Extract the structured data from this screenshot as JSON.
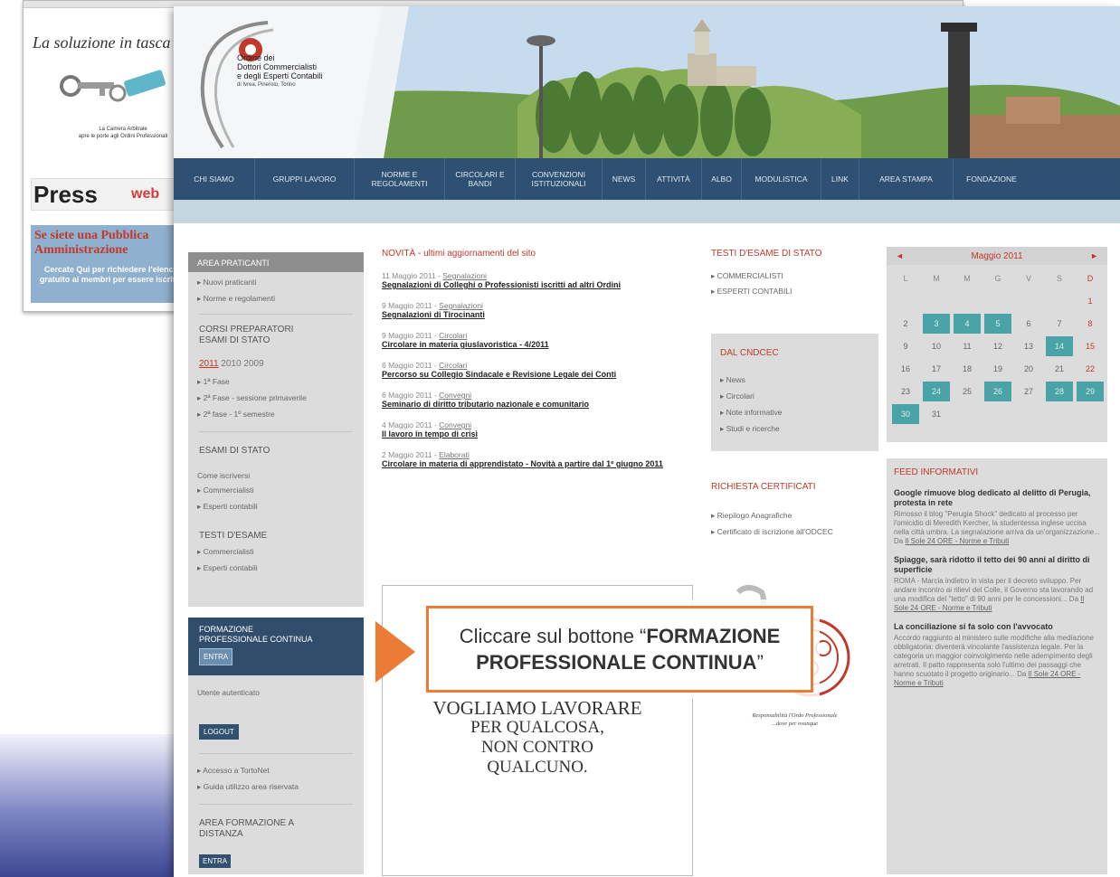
{
  "background_window": {
    "tagline": "La soluzione in tasca",
    "keys_caption_1": "La Camera Arbitrale",
    "keys_caption_2": "apre le porte agli Ordini Professionali",
    "press_label": "Press",
    "press_suffix": "web",
    "ad_title": "Se siete una Pubblica Amministrazione",
    "ad_body": "Cercate Qui per richiedere l'elenco gratuito ai membri per essere iscritti!"
  },
  "header": {
    "org_line1": "Ordine dei",
    "org_line2": "Dottori Commercialisti",
    "org_line3": "e degli Esperti Contabili",
    "org_line4": "di Ivrea, Pinerolo, Torino"
  },
  "nav": {
    "items": [
      "CHI SIAMO",
      "GRUPPI LAVORO",
      "NORME E REGOLAMENTI",
      "CIRCOLARI E BANDI",
      "CONVENZIONI ISTITUZIONALI",
      "NEWS",
      "ATTIVITÀ",
      "ALBO",
      "MODULISTICA",
      "LINK",
      "AREA STAMPA",
      "FONDAZIONE"
    ]
  },
  "left": {
    "area_praticanti": "AREA PRATICANTI",
    "praticanti_items": [
      "Nuovi praticanti",
      "Norme e regolamenti"
    ],
    "corsi_head_1": "CORSI PREPARATORI",
    "corsi_head_2": "ESAMI DI STATO",
    "year_selected": "2011",
    "year_2": "2010",
    "year_3": "2009",
    "fasi": [
      "1ª Fase",
      "2ª Fase - sessione primaverile",
      "2ª fase - 1º semestre"
    ],
    "esami_head": "ESAMI DI STATO",
    "esami_sub": "Come iscriversi",
    "esami_items": [
      "Commercialisti",
      "Esperti contabili"
    ],
    "testi_head": "TESTI D'ESAME",
    "testi_items": [
      "Commercialisti",
      "Esperti contabili"
    ],
    "fpc_title_1": "FORMAZIONE",
    "fpc_title_2": "PROFESSIONALE CONTINUA",
    "entra": "ENTRA",
    "utente": "Utente autenticato",
    "logout": "LOGOUT",
    "fpc_links": [
      "Accesso a TortoNet",
      "Guida utilizzo area riservata"
    ],
    "distanza_1": "AREA FORMAZIONE A",
    "distanza_2": "DISTANZA",
    "entra2": "ENTRA"
  },
  "news": {
    "title": "NOVITÀ - ultimi aggiornamenti del sito",
    "items": [
      {
        "date": "11 Maggio 2011 - ",
        "cat": "Segnalazioni",
        "title": "Segnalazioni di Colleghi o Professionisti iscritti ad altri Ordini"
      },
      {
        "date": "9 Maggio 2011 - ",
        "cat": "Segnalazioni",
        "title": "Segnalazioni di Tirocinanti"
      },
      {
        "date": "9 Maggio 2011 - ",
        "cat": "Circolari",
        "title": "Circolare in materia giuslavoristica - 4/2011"
      },
      {
        "date": "6 Maggio 2011 - ",
        "cat": "Circolari",
        "title": "Percorso su Collegio Sindacale e Revisione Legale dei Conti"
      },
      {
        "date": "6 Maggio 2011 - ",
        "cat": "Convegni",
        "title": "Seminario di diritto tributario nazionale e comunitario"
      },
      {
        "date": "4 Maggio 2011 - ",
        "cat": "Convegni",
        "title": "Il lavoro in tempo di crisi"
      },
      {
        "date": "2 Maggio 2011 - ",
        "cat": "Elaborati",
        "title": "Circolare in materia di apprendistato - Novità a partire dal 1º giugno 2011"
      }
    ],
    "poster_line1": "VOGLIAMO LAVORARE",
    "poster_line2": "PER QUALCOSA,",
    "poster_line3": "NON CONTRO",
    "poster_line4": "QUALCUNO."
  },
  "col3": {
    "testi_title": "TESTI D'ESAME DI STATO",
    "testi_items": [
      "COMMERCIALISTI",
      "ESPERTI CONTABILI"
    ],
    "dal_title": "DAL CNDCEC",
    "dal_items": [
      "News",
      "Circolari",
      "Note informative",
      "Studi e ricerche"
    ],
    "cert_title": "RICHIESTA CERTIFICATI",
    "cert_items": [
      "Riepilogo Anagrafiche",
      "Certificato di iscrizione all'ODCEC"
    ],
    "seal_caption_1": "Responsabilità l'Ordo Professionale",
    "seal_caption_2": "...dove per ovunque"
  },
  "calendar": {
    "month": "Maggio 2011",
    "prev": "◄",
    "next": "►",
    "weekdays": [
      "L",
      "M",
      "M",
      "G",
      "V",
      "S",
      "D"
    ]
  },
  "feed": {
    "title": "FEED INFORMATIVI",
    "items": [
      {
        "title": "Google rimuove blog dedicato al delitto di Perugia, protesta in rete",
        "body": "Rimosso il blog \"Perugia Shock\" dedicato al processo per l'omicidio di Meredith Kercher, la studentessa inglese uccisa nella città umbra. La segnalazione arriva da un'organizzazione... Da ",
        "src": "Il Sole 24 ORE - Norme e Tributi"
      },
      {
        "title": "Spiagge, sarà ridotto il tetto dei 90 anni al diritto di superficie",
        "body": "ROMA - Marcia indietro in vista per il decreto sviluppo. Per andare incontro ai rilievi del Colle, il Governo sta lavorando ad una modifica del \"tetto\" di 90 anni per le concessioni... Da ",
        "src": "Il Sole 24 ORE - Norme e Tributi"
      },
      {
        "title": "La conciliazione si fa solo con l'avvocato",
        "body": "Accordo raggiunto al ministero sulle modifiche alla mediazione obbligatoria: diventerà vincolante l'assistenza legale. Per la categoria un maggior coinvolgimento nelle adempimento degli arretrati. Il patto rappresenta solo l'ultimo dei passaggi che hanno scuotato il progetto originario... Da ",
        "src": "Il Sole 24 ORE - Norme e Tributi"
      }
    ]
  },
  "callout": {
    "prefix": "Cliccare sul bottone “",
    "bold_1": "FORMAZIONE",
    "bold_2": "PROFESSIONALE CONTINUA",
    "suffix": "”"
  },
  "colors": {
    "nav_bg": "#2e5072",
    "accent_red": "#c0392b",
    "calendar_highlight": "#4aa3a6",
    "callout_orange": "#ea7c35"
  }
}
